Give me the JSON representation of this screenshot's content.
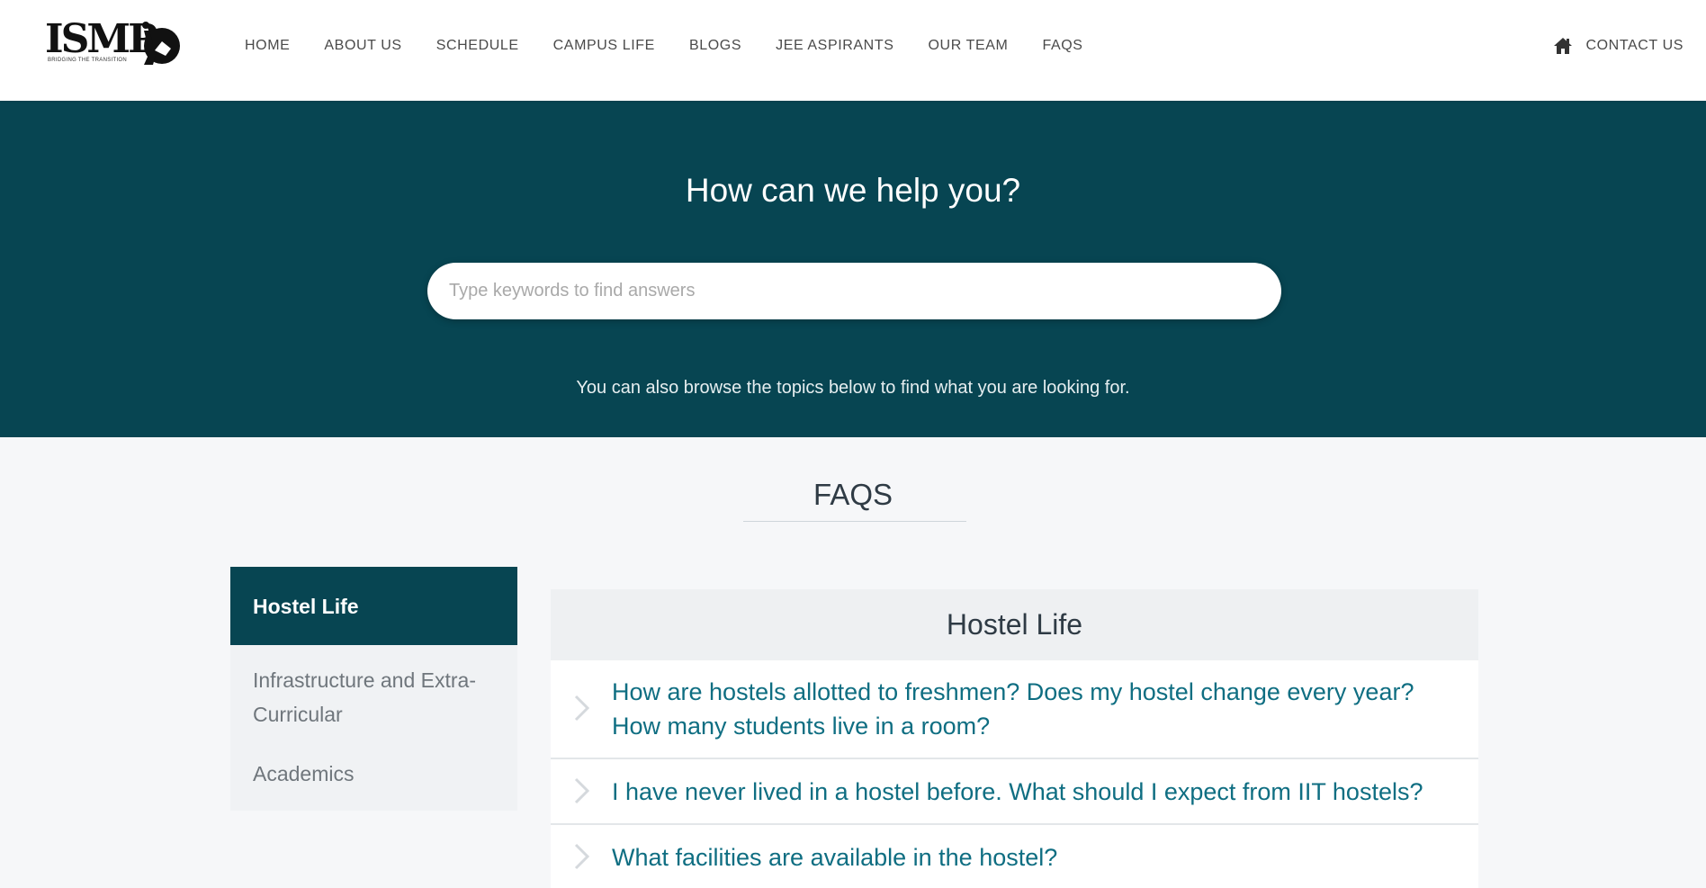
{
  "logo": {
    "text": "ISMP",
    "tagline": "BRIDGING THE TRANSITION"
  },
  "nav": {
    "items": [
      {
        "label": "HOME"
      },
      {
        "label": "ABOUT US"
      },
      {
        "label": "SCHEDULE"
      },
      {
        "label": "CAMPUS LIFE"
      },
      {
        "label": "BLOGS"
      },
      {
        "label": "JEE ASPIRANTS"
      },
      {
        "label": "OUR TEAM"
      },
      {
        "label": "FAQS"
      }
    ],
    "contact_label": "CONTACT US",
    "contact_icon": "home-icon"
  },
  "hero": {
    "title": "How can we help you?",
    "search_placeholder": "Type keywords to find answers",
    "subtitle": "You can also browse the topics below to find what you are looking for."
  },
  "faq": {
    "heading": "FAQS",
    "categories": [
      {
        "label": "Hostel Life",
        "active": true
      },
      {
        "label": "Infrastructure and Extra-Curricular",
        "active": false
      },
      {
        "label": "Academics",
        "active": false
      }
    ],
    "panel_title": "Hostel Life",
    "questions": [
      {
        "text": "How are hostels allotted to freshmen? Does my hostel change every year? How many students live in a room?"
      },
      {
        "text": "I have never lived in a hostel before. What should I expect from IIT hostels?"
      },
      {
        "text": "What facilities are available in the hostel?"
      }
    ]
  },
  "colors": {
    "primary": "#074552",
    "link": "#0f6e82",
    "background": "#f6f7f9"
  }
}
